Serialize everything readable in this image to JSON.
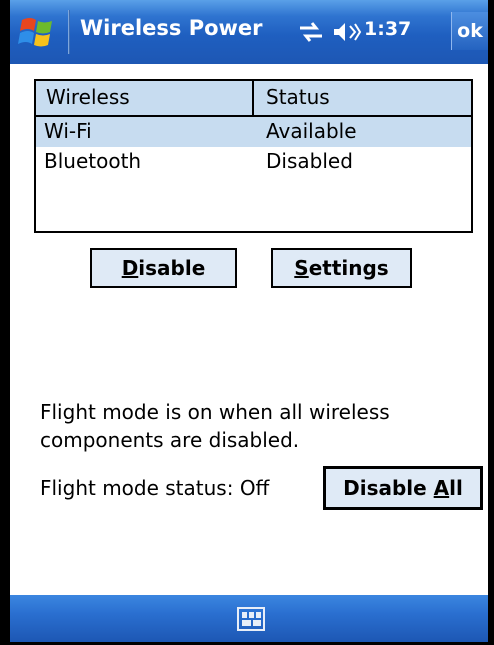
{
  "titlebar": {
    "title": "Wireless Power",
    "time": "1:37",
    "ok_label": "ok",
    "start_icon": "windows-flag-icon",
    "connectivity_icon": "connectivity-icon",
    "volume_icon": "speaker-icon"
  },
  "list": {
    "columns": [
      "Wireless",
      "Status"
    ],
    "rows": [
      {
        "name": "Wi-Fi",
        "status": "Available",
        "selected": true
      },
      {
        "name": "Bluetooth",
        "status": "Disabled",
        "selected": false
      }
    ]
  },
  "buttons": {
    "disable": {
      "mnemonic": "D",
      "rest": "isable"
    },
    "settings": {
      "mnemonic": "S",
      "rest": "ettings"
    },
    "disable_all": {
      "prefix": "Disable ",
      "mnemonic": "A",
      "rest": "ll"
    }
  },
  "info_text": "Flight mode is on when all wireless components are disabled.",
  "flight_status": "Flight mode status: Off",
  "bottombar": {
    "keyboard_icon": "keyboard-icon"
  },
  "colors": {
    "titlebar": "#1f5fc0",
    "header_bg": "#c7dcf0",
    "button_bg": "#dfeaf6"
  }
}
